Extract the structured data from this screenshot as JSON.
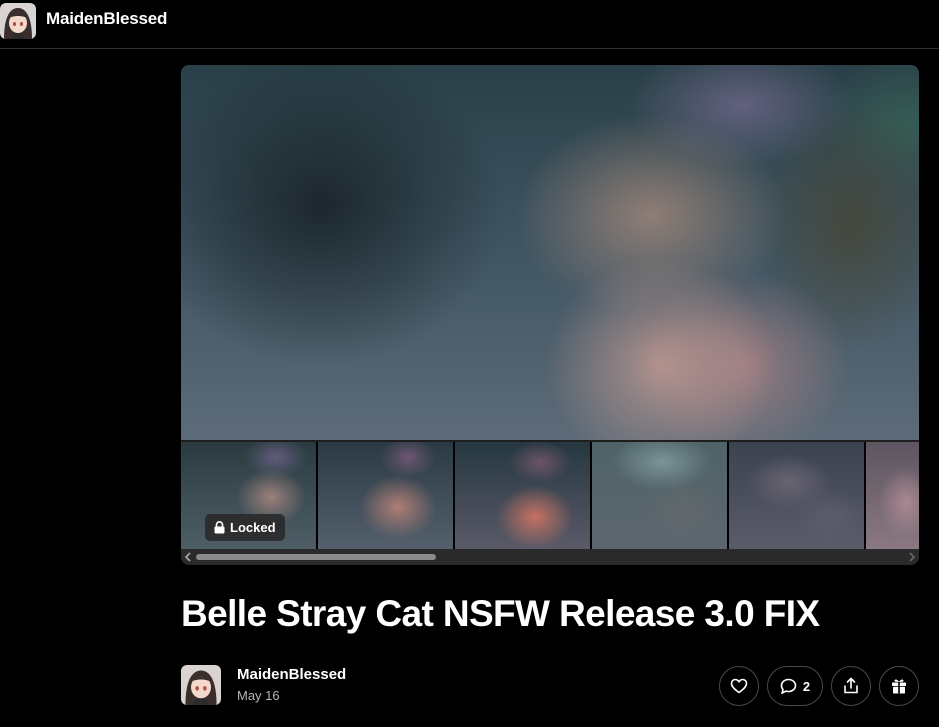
{
  "header": {
    "creator_name": "MaidenBlessed",
    "avatar_icon": "creator-avatar"
  },
  "media": {
    "locked_label": "Locked",
    "thumbnail_count_visible": 6,
    "colors": {
      "background": "#000000",
      "badge_background": "#282828"
    }
  },
  "post": {
    "title": "Belle Stray Cat NSFW Release 3.0 FIX",
    "author_name": "MaidenBlessed",
    "date": "May 16"
  },
  "actions": {
    "like_icon": "heart-icon",
    "comment_icon": "comment-icon",
    "comment_count": "2",
    "share_icon": "share-icon",
    "gift_icon": "gift-icon"
  }
}
